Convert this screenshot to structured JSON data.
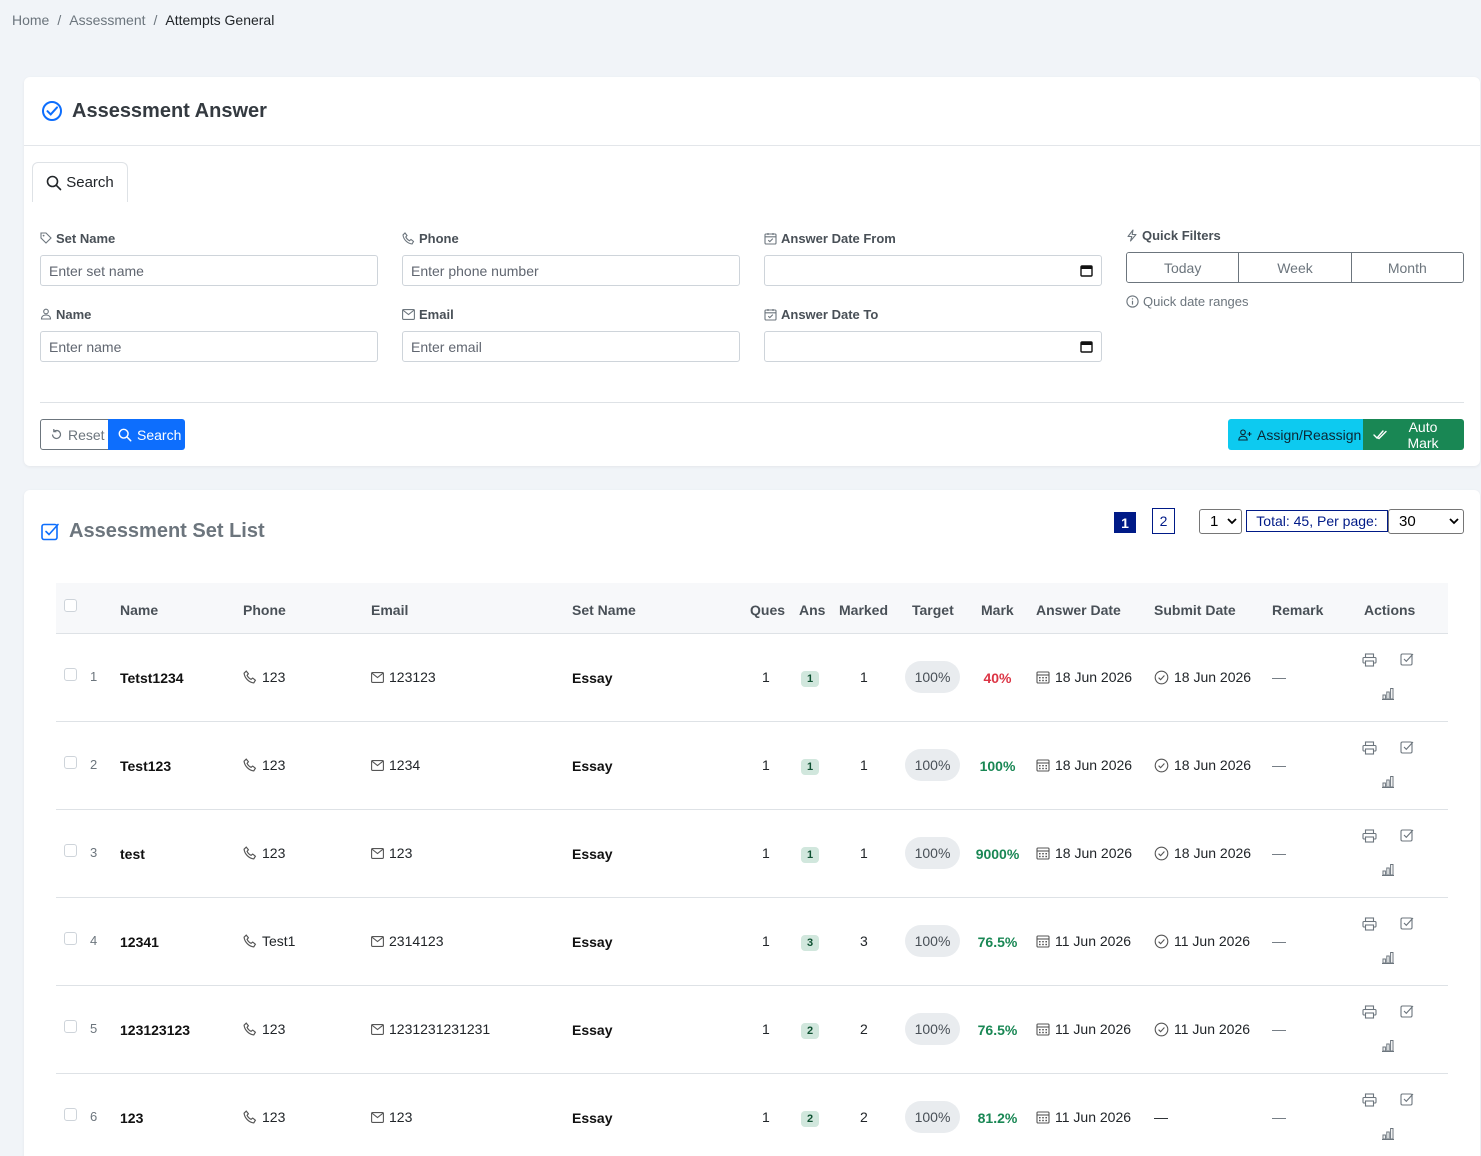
{
  "breadcrumb": [
    "Home",
    "Assessment",
    "Attempts General"
  ],
  "search_card": {
    "title": "Assessment Answer",
    "tab": "Search",
    "fields": {
      "set_name": {
        "label": "Set Name",
        "placeholder": "Enter set name"
      },
      "phone": {
        "label": "Phone",
        "placeholder": "Enter phone number"
      },
      "answer_date_from": {
        "label": "Answer Date From"
      },
      "name": {
        "label": "Name",
        "placeholder": "Enter name"
      },
      "email": {
        "label": "Email",
        "placeholder": "Enter email"
      },
      "answer_date_to": {
        "label": "Answer Date To"
      }
    },
    "quick_filters": {
      "label": "Quick Filters",
      "options": [
        "Today",
        "Week",
        "Month"
      ],
      "hint": "Quick date ranges"
    },
    "buttons": {
      "reset": "Reset",
      "search": "Search",
      "assign": "Assign/Reassign",
      "auto_mark": "Auto Mark"
    }
  },
  "list_card": {
    "title": "Assessment Set List",
    "pagination": {
      "pages": [
        "1",
        "2"
      ],
      "current": "1",
      "page_select": "1",
      "total_text": "Total: 45, Per page:",
      "per_page": "30"
    },
    "columns": [
      "Name",
      "Phone",
      "Email",
      "Set Name",
      "Ques",
      "Ans",
      "Marked",
      "Target",
      "Mark",
      "Answer Date",
      "Submit Date",
      "Remark",
      "Actions"
    ],
    "rows": [
      {
        "no": "1",
        "name": "Tetst1234",
        "phone": "123",
        "email": "123123",
        "set_name": "Essay",
        "ques": "1",
        "ans": "1",
        "marked": "1",
        "target": "100%",
        "mark": "40%",
        "mark_status": "low",
        "answer_date": "18 Jun 2026",
        "submit_date": "18 Jun 2026",
        "remark": "—"
      },
      {
        "no": "2",
        "name": "Test123",
        "phone": "123",
        "email": "1234",
        "set_name": "Essay",
        "ques": "1",
        "ans": "1",
        "marked": "1",
        "target": "100%",
        "mark": "100%",
        "mark_status": "pass",
        "answer_date": "18 Jun 2026",
        "submit_date": "18 Jun 2026",
        "remark": "—"
      },
      {
        "no": "3",
        "name": "test",
        "phone": "123",
        "email": "123",
        "set_name": "Essay",
        "ques": "1",
        "ans": "1",
        "marked": "1",
        "target": "100%",
        "mark": "9000%",
        "mark_status": "pass",
        "answer_date": "18 Jun 2026",
        "submit_date": "18 Jun 2026",
        "remark": "—"
      },
      {
        "no": "4",
        "name": "12341",
        "phone": "Test1",
        "email": "2314123",
        "set_name": "Essay",
        "ques": "1",
        "ans": "3",
        "marked": "3",
        "target": "100%",
        "mark": "76.5%",
        "mark_status": "pass",
        "answer_date": "11 Jun 2026",
        "submit_date": "11 Jun 2026",
        "remark": "—"
      },
      {
        "no": "5",
        "name": "123123123",
        "phone": "123",
        "email": "1231231231231",
        "set_name": "Essay",
        "ques": "1",
        "ans": "2",
        "marked": "2",
        "target": "100%",
        "mark": "76.5%",
        "mark_status": "pass",
        "answer_date": "11 Jun 2026",
        "submit_date": "11 Jun 2026",
        "remark": "—"
      },
      {
        "no": "6",
        "name": "123",
        "phone": "123",
        "email": "123",
        "set_name": "Essay",
        "ques": "1",
        "ans": "2",
        "marked": "2",
        "target": "100%",
        "mark": "81.2%",
        "mark_status": "pass",
        "answer_date": "11 Jun 2026",
        "submit_date": "—",
        "remark": "—"
      }
    ]
  },
  "colors": {
    "primary": "#0d6efd",
    "success": "#198754",
    "danger": "#dc3545",
    "info": "#0dcaf0",
    "pager": "#001a87"
  }
}
